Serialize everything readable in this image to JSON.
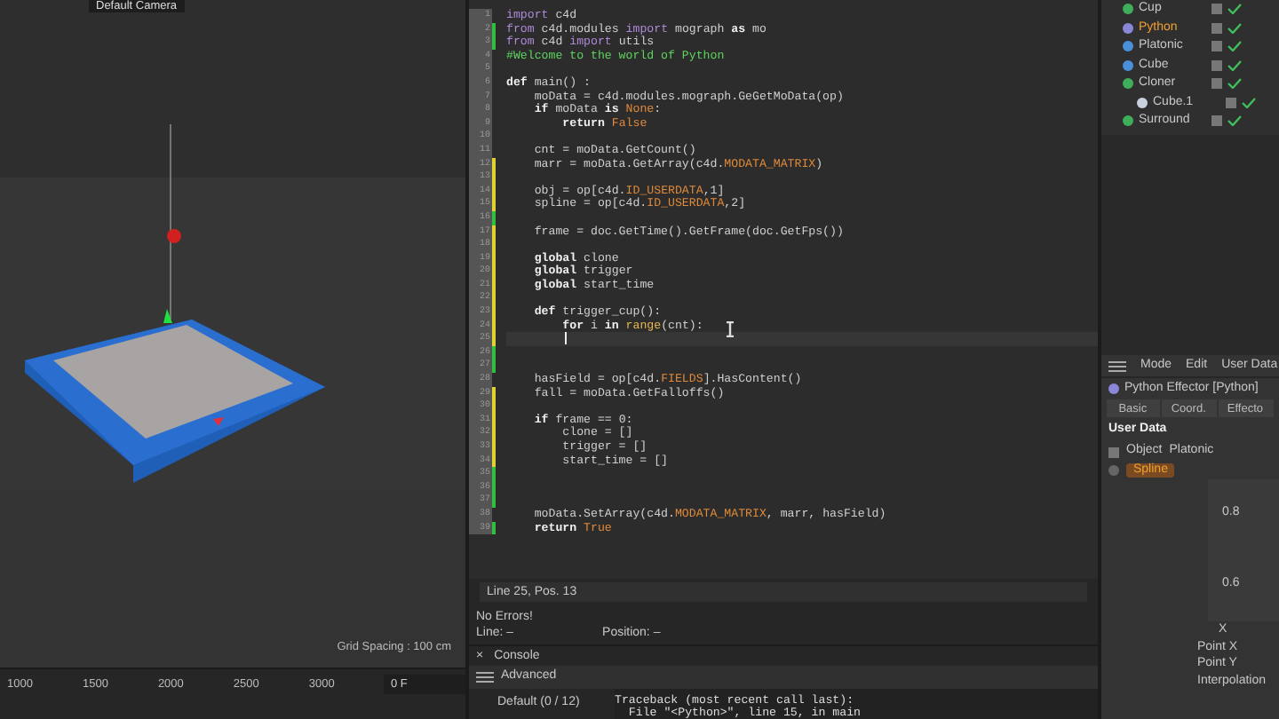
{
  "viewport": {
    "camera": "Default Camera",
    "grid_spacing": "Grid Spacing : 100 cm"
  },
  "timeline": {
    "ticks": [
      "1000",
      "1500",
      "2000",
      "2500",
      "3000"
    ],
    "current_frame": "0 F"
  },
  "editor": {
    "lines": [
      {
        "number": "1",
        "current": false,
        "tokens": [
          {
            "kind": "import",
            "text": "import"
          },
          {
            "kind": "plain",
            "text": " c4d"
          }
        ]
      },
      {
        "number": "2",
        "current": false,
        "color": "#2fc040",
        "tokens": [
          {
            "kind": "import",
            "text": "from"
          },
          {
            "kind": "plain",
            "text": " c4d.modules "
          },
          {
            "kind": "import",
            "text": "import"
          },
          {
            "kind": "plain",
            "text": " mograph "
          },
          {
            "kind": "keyword",
            "text": "as"
          },
          {
            "kind": "plain",
            "text": " mo"
          }
        ]
      },
      {
        "number": "3",
        "current": false,
        "color": "#2fc040",
        "tokens": [
          {
            "kind": "import",
            "text": "from"
          },
          {
            "kind": "plain",
            "text": " c4d "
          },
          {
            "kind": "import",
            "text": "import"
          },
          {
            "kind": "plain",
            "text": " utils"
          }
        ]
      },
      {
        "number": "4",
        "current": false,
        "tokens": [
          {
            "kind": "comment",
            "text": "#Welcome to the world of Python"
          }
        ]
      },
      {
        "number": "5",
        "current": false
      },
      {
        "number": "6",
        "current": false,
        "tokens": [
          {
            "kind": "keyword",
            "text": "def"
          },
          {
            "kind": "plain",
            "text": " main() :"
          }
        ]
      },
      {
        "number": "7",
        "current": false,
        "tokens": [
          {
            "kind": "plain",
            "text": "    moData = c4d.modules.mograph.GeGetMoData(op)"
          }
        ]
      },
      {
        "number": "8",
        "current": false,
        "tokens": [
          {
            "kind": "keyword",
            "text": "    if"
          },
          {
            "kind": "plain",
            "text": " moData "
          },
          {
            "kind": "keyword",
            "text": "is"
          },
          {
            "kind": "constant",
            "text": " None"
          },
          {
            "kind": "plain",
            "text": ":"
          }
        ]
      },
      {
        "number": "9",
        "current": false,
        "tokens": [
          {
            "kind": "keyword",
            "text": "        return"
          },
          {
            "kind": "constant",
            "text": " False"
          }
        ]
      },
      {
        "number": "10",
        "current": false
      },
      {
        "number": "11",
        "current": false,
        "tokens": [
          {
            "kind": "plain",
            "text": "    cnt = moData.GetCount()"
          }
        ]
      },
      {
        "number": "12",
        "current": false,
        "color": "#e0d030",
        "tokens": [
          {
            "kind": "plain",
            "text": "    marr = moData.GetArray(c4d."
          },
          {
            "kind": "constant",
            "text": "MODATA_MATRIX"
          },
          {
            "kind": "plain",
            "text": ")"
          }
        ]
      },
      {
        "number": "13",
        "current": false,
        "color": "#e0d030"
      },
      {
        "number": "14",
        "current": false,
        "color": "#e0d030",
        "tokens": [
          {
            "kind": "plain",
            "text": "    obj = op[c4d."
          },
          {
            "kind": "constant",
            "text": "ID_USERDATA"
          },
          {
            "kind": "plain",
            "text": ",1]"
          }
        ]
      },
      {
        "number": "15",
        "current": false,
        "color": "#e0d030",
        "tokens": [
          {
            "kind": "plain",
            "text": "    spline = op[c4d."
          },
          {
            "kind": "constant",
            "text": "ID_USERDATA"
          },
          {
            "kind": "plain",
            "text": ",2]"
          }
        ]
      },
      {
        "number": "16",
        "current": false,
        "color": "#2fc040"
      },
      {
        "number": "17",
        "current": false,
        "color": "#e0d030",
        "tokens": [
          {
            "kind": "plain",
            "text": "    frame = doc.GetTime().GetFrame(doc.GetFps())"
          }
        ]
      },
      {
        "number": "18",
        "current": false,
        "color": "#e0d030"
      },
      {
        "number": "19",
        "current": false,
        "color": "#e0d030",
        "tokens": [
          {
            "kind": "keyword",
            "text": "    global"
          },
          {
            "kind": "plain",
            "text": " clone"
          }
        ]
      },
      {
        "number": "20",
        "current": false,
        "color": "#e0d030",
        "tokens": [
          {
            "kind": "keyword",
            "text": "    global"
          },
          {
            "kind": "plain",
            "text": " trigger"
          }
        ]
      },
      {
        "number": "21",
        "current": false,
        "color": "#e0d030",
        "tokens": [
          {
            "kind": "keyword",
            "text": "    global"
          },
          {
            "kind": "plain",
            "text": " start_time"
          }
        ]
      },
      {
        "number": "22",
        "current": false,
        "color": "#e0d030"
      },
      {
        "number": "23",
        "current": false,
        "color": "#e0d030",
        "tokens": [
          {
            "kind": "keyword",
            "text": "    def"
          },
          {
            "kind": "plain",
            "text": " trigger_cup():"
          }
        ]
      },
      {
        "number": "24",
        "current": false,
        "color": "#e0d030",
        "tokens": [
          {
            "kind": "keyword",
            "text": "        for"
          },
          {
            "kind": "plain",
            "text": " i "
          },
          {
            "kind": "keyword",
            "text": "in"
          },
          {
            "kind": "builtin",
            "text": " range"
          },
          {
            "kind": "plain",
            "text": "(cnt):"
          }
        ]
      },
      {
        "number": "25",
        "current": true,
        "color": "#e0d030"
      },
      {
        "number": "26",
        "current": false,
        "color": "#2fc040"
      },
      {
        "number": "27",
        "current": false,
        "color": "#2fc040"
      },
      {
        "number": "28",
        "current": false,
        "tokens": [
          {
            "kind": "plain",
            "text": "    hasField = op[c4d."
          },
          {
            "kind": "constant",
            "text": "FIELDS"
          },
          {
            "kind": "plain",
            "text": "].HasContent()"
          }
        ]
      },
      {
        "number": "29",
        "current": false,
        "color": "#e0d030",
        "tokens": [
          {
            "kind": "plain",
            "text": "    fall = moData.GetFalloffs()"
          }
        ]
      },
      {
        "number": "30",
        "current": false,
        "color": "#e0d030"
      },
      {
        "number": "31",
        "current": false,
        "color": "#e0d030",
        "tokens": [
          {
            "kind": "keyword",
            "text": "    if"
          },
          {
            "kind": "plain",
            "text": " frame == 0:"
          }
        ]
      },
      {
        "number": "32",
        "current": false,
        "color": "#e0d030",
        "tokens": [
          {
            "kind": "plain",
            "text": "        clone = []"
          }
        ]
      },
      {
        "number": "33",
        "current": false,
        "color": "#e0d030",
        "tokens": [
          {
            "kind": "plain",
            "text": "        trigger = []"
          }
        ]
      },
      {
        "number": "34",
        "current": false,
        "color": "#e0d030",
        "tokens": [
          {
            "kind": "plain",
            "text": "        start_time = []"
          }
        ]
      },
      {
        "number": "35",
        "current": false,
        "color": "#2fc040"
      },
      {
        "number": "36",
        "current": false,
        "color": "#2fc040"
      },
      {
        "number": "37",
        "current": false,
        "color": "#2fc040"
      },
      {
        "number": "38",
        "current": false,
        "tokens": [
          {
            "kind": "plain",
            "text": "    moData.SetArray(c4d."
          },
          {
            "kind": "constant",
            "text": "MODATA_MATRIX"
          },
          {
            "kind": "plain",
            "text": ", marr, hasField)"
          }
        ]
      },
      {
        "number": "39",
        "current": false,
        "color": "#2fc040",
        "tokens": [
          {
            "kind": "keyword",
            "text": "    return"
          },
          {
            "kind": "constant",
            "text": " True"
          }
        ]
      }
    ],
    "status": "Line 25, Pos. 13"
  },
  "errors": {
    "message": "No Errors!",
    "line": "Line: –",
    "position": "Position: –"
  },
  "console": {
    "close": "×",
    "title": "Console",
    "filter": "Advanced",
    "source": "Default (0 / 12)",
    "output": [
      "Traceback (most recent call last):",
      "  File \"<Python>\", line 15, in main"
    ]
  },
  "objects": [
    {
      "name": "Cup",
      "selected": false,
      "color": "#3fae5a"
    },
    {
      "name": "Python",
      "selected": true,
      "color": "#8a86d8"
    },
    {
      "name": "Platonic",
      "selected": false,
      "color": "#4a8fd8"
    },
    {
      "name": "Cube",
      "selected": false,
      "color": "#4a8fd8"
    },
    {
      "name": "Cloner",
      "selected": false,
      "color": "#3fae5a",
      "children": [
        {
          "name": "Cube.1",
          "selected": false,
          "color": "#c8d0e0"
        }
      ]
    },
    {
      "name": "Surround",
      "selected": false,
      "color": "#3fae5a"
    }
  ],
  "attributes": {
    "menu": [
      "Mode",
      "Edit",
      "User Data"
    ],
    "title": "Python Effector [Python]",
    "tabs": [
      {
        "label": "Basic",
        "selected": false
      },
      {
        "label": "Coord.",
        "selected": false
      },
      {
        "label": "Effecto",
        "selected": false
      }
    ],
    "section": "User Data",
    "object_label": "Object",
    "object_value": "Platonic",
    "spline_label": "Spline",
    "graph": {
      "y_labels": [
        "0.8",
        "0.6"
      ],
      "x_label": "X"
    },
    "rows": [
      "Point X",
      "Point Y",
      "Interpolation"
    ]
  }
}
